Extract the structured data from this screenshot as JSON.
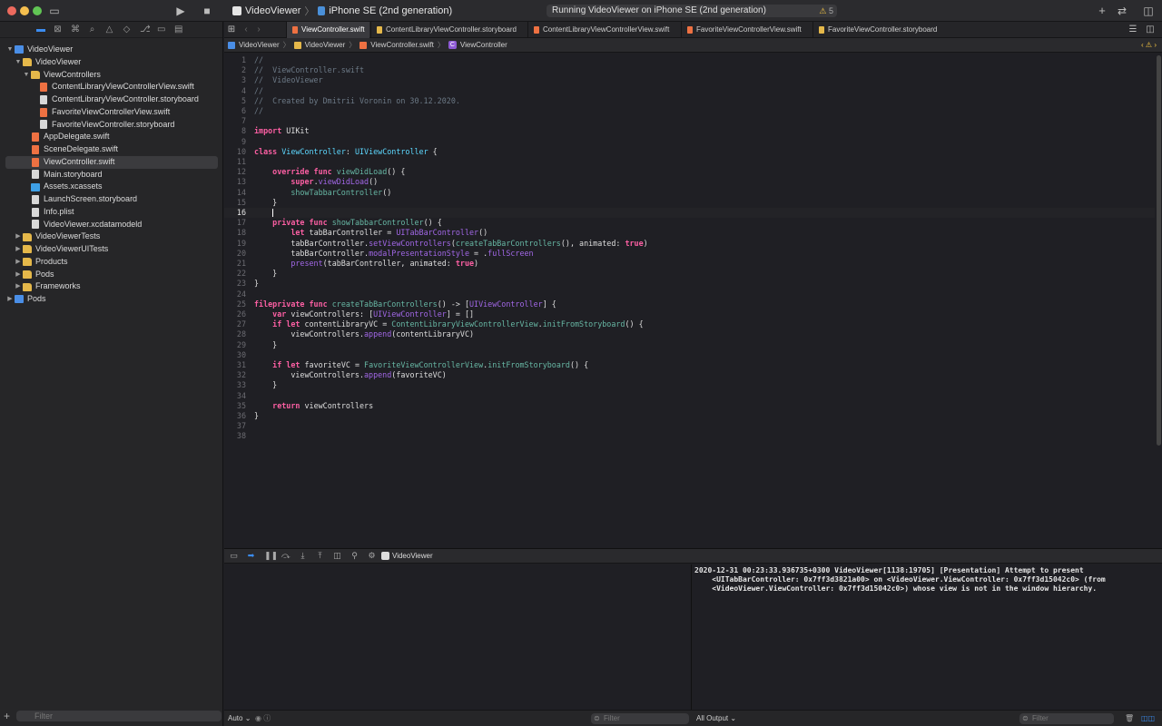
{
  "titlebar": {
    "scheme_name": "VideoViewer",
    "device": "iPhone SE (2nd generation)",
    "status": "Running VideoViewer on iPhone SE (2nd generation)",
    "warning_count": "5"
  },
  "navigator": {
    "filter_placeholder": "Filter",
    "items": [
      {
        "label": "VideoViewer",
        "indent": 0,
        "disclosure": "open",
        "icon": "project"
      },
      {
        "label": "VideoViewer",
        "indent": 1,
        "disclosure": "open",
        "icon": "folder"
      },
      {
        "label": "ViewControllers",
        "indent": 2,
        "disclosure": "open",
        "icon": "folder"
      },
      {
        "label": "ContentLibraryViewControllerView.swift",
        "indent": 3,
        "disclosure": "none",
        "icon": "swift"
      },
      {
        "label": "ContentLibraryViewController.storyboard",
        "indent": 3,
        "disclosure": "none",
        "icon": "file"
      },
      {
        "label": "FavoriteViewControllerView.swift",
        "indent": 3,
        "disclosure": "none",
        "icon": "swift"
      },
      {
        "label": "FavoriteViewController.storyboard",
        "indent": 3,
        "disclosure": "none",
        "icon": "file"
      },
      {
        "label": "AppDelegate.swift",
        "indent": 2,
        "disclosure": "none",
        "icon": "swift"
      },
      {
        "label": "SceneDelegate.swift",
        "indent": 2,
        "disclosure": "none",
        "icon": "swift"
      },
      {
        "label": "ViewController.swift",
        "indent": 2,
        "disclosure": "none",
        "icon": "swift",
        "selected": true
      },
      {
        "label": "Main.storyboard",
        "indent": 2,
        "disclosure": "none",
        "icon": "file"
      },
      {
        "label": "Assets.xcassets",
        "indent": 2,
        "disclosure": "none",
        "icon": "assets"
      },
      {
        "label": "LaunchScreen.storyboard",
        "indent": 2,
        "disclosure": "none",
        "icon": "file"
      },
      {
        "label": "Info.plist",
        "indent": 2,
        "disclosure": "none",
        "icon": "file"
      },
      {
        "label": "VideoViewer.xcdatamodeld",
        "indent": 2,
        "disclosure": "none",
        "icon": "file"
      },
      {
        "label": "VideoViewerTests",
        "indent": 1,
        "disclosure": "closed",
        "icon": "folder"
      },
      {
        "label": "VideoViewerUITests",
        "indent": 1,
        "disclosure": "closed",
        "icon": "folder"
      },
      {
        "label": "Products",
        "indent": 1,
        "disclosure": "closed",
        "icon": "folder"
      },
      {
        "label": "Pods",
        "indent": 1,
        "disclosure": "closed",
        "icon": "folder"
      },
      {
        "label": "Frameworks",
        "indent": 1,
        "disclosure": "closed",
        "icon": "folder"
      },
      {
        "label": "Pods",
        "indent": 0,
        "disclosure": "closed",
        "icon": "project"
      }
    ]
  },
  "tabs": [
    {
      "label": "ViewController.swift",
      "type": "swift",
      "active": true
    },
    {
      "label": "ContentLibraryViewController.storyboard",
      "type": "storyboard",
      "active": false
    },
    {
      "label": "ContentLibraryViewControllerView.swift",
      "type": "swift",
      "active": false
    },
    {
      "label": "FavoriteViewControllerView.swift",
      "type": "swift",
      "active": false
    },
    {
      "label": "FavoriteViewController.storyboard",
      "type": "storyboard",
      "active": false
    }
  ],
  "jumpbar": [
    "VideoViewer",
    "VideoViewer",
    "ViewController.swift",
    "ViewController"
  ],
  "editor": {
    "current_line": 16,
    "lines": [
      [
        [
          "c",
          "//"
        ]
      ],
      [
        [
          "c",
          "//  ViewController.swift"
        ]
      ],
      [
        [
          "c",
          "//  VideoViewer"
        ]
      ],
      [
        [
          "c",
          "//"
        ]
      ],
      [
        [
          "c",
          "//  Created by Dmitrii Voronin on 30.12.2020."
        ]
      ],
      [
        [
          "c",
          "//"
        ]
      ],
      [],
      [
        [
          "k",
          "import"
        ],
        [
          "p",
          " UIKit"
        ]
      ],
      [],
      [
        [
          "k",
          "class"
        ],
        [
          "p",
          " "
        ],
        [
          "t",
          "ViewController"
        ],
        [
          "p",
          ": "
        ],
        [
          "t",
          "UIViewController"
        ],
        [
          "p",
          " {"
        ]
      ],
      [],
      [
        [
          "p",
          "    "
        ],
        [
          "k",
          "override func"
        ],
        [
          "p",
          " "
        ],
        [
          "f",
          "viewDidLoad"
        ],
        [
          "p",
          "() {"
        ]
      ],
      [
        [
          "p",
          "        "
        ],
        [
          "k",
          "super"
        ],
        [
          "p",
          "."
        ],
        [
          "m",
          "viewDidLoad"
        ],
        [
          "p",
          "()"
        ]
      ],
      [
        [
          "p",
          "        "
        ],
        [
          "f",
          "showTabbarController"
        ],
        [
          "p",
          "()"
        ]
      ],
      [
        [
          "p",
          "    }"
        ]
      ],
      [
        [
          "p",
          "    "
        ]
      ],
      [
        [
          "p",
          "    "
        ],
        [
          "k",
          "private func"
        ],
        [
          "p",
          " "
        ],
        [
          "f",
          "showTabbarController"
        ],
        [
          "p",
          "() {"
        ]
      ],
      [
        [
          "p",
          "        "
        ],
        [
          "k",
          "let"
        ],
        [
          "p",
          " tabBarController = "
        ],
        [
          "m",
          "UITabBarController"
        ],
        [
          "p",
          "()"
        ]
      ],
      [
        [
          "p",
          "        tabBarController."
        ],
        [
          "m",
          "setViewControllers"
        ],
        [
          "p",
          "("
        ],
        [
          "f",
          "createTabBarControllers"
        ],
        [
          "p",
          "(), animated: "
        ],
        [
          "k",
          "true"
        ],
        [
          "p",
          ")"
        ]
      ],
      [
        [
          "p",
          "        tabBarController."
        ],
        [
          "m",
          "modalPresentationStyle"
        ],
        [
          "p",
          " = ."
        ],
        [
          "m",
          "fullScreen"
        ]
      ],
      [
        [
          "p",
          "        "
        ],
        [
          "m",
          "present"
        ],
        [
          "p",
          "(tabBarController, animated: "
        ],
        [
          "k",
          "true"
        ],
        [
          "p",
          ")"
        ]
      ],
      [
        [
          "p",
          "    }"
        ]
      ],
      [
        [
          "p",
          "}"
        ]
      ],
      [],
      [
        [
          "k",
          "fileprivate func"
        ],
        [
          "p",
          " "
        ],
        [
          "f",
          "createTabBarControllers"
        ],
        [
          "p",
          "() -> ["
        ],
        [
          "m",
          "UIViewController"
        ],
        [
          "p",
          "] {"
        ]
      ],
      [
        [
          "p",
          "    "
        ],
        [
          "k",
          "var"
        ],
        [
          "p",
          " viewControllers: ["
        ],
        [
          "m",
          "UIViewController"
        ],
        [
          "p",
          "] = []"
        ]
      ],
      [
        [
          "p",
          "    "
        ],
        [
          "k",
          "if let"
        ],
        [
          "p",
          " contentLibraryVC = "
        ],
        [
          "f",
          "ContentLibraryViewControllerView"
        ],
        [
          "p",
          "."
        ],
        [
          "f",
          "initFromStoryboard"
        ],
        [
          "p",
          "() {"
        ]
      ],
      [
        [
          "p",
          "        viewControllers."
        ],
        [
          "m",
          "append"
        ],
        [
          "p",
          "(contentLibraryVC)"
        ]
      ],
      [
        [
          "p",
          "    }"
        ]
      ],
      [],
      [
        [
          "p",
          "    "
        ],
        [
          "k",
          "if let"
        ],
        [
          "p",
          " favoriteVC = "
        ],
        [
          "f",
          "FavoriteViewControllerView"
        ],
        [
          "p",
          "."
        ],
        [
          "f",
          "initFromStoryboard"
        ],
        [
          "p",
          "() {"
        ]
      ],
      [
        [
          "p",
          "        viewControllers."
        ],
        [
          "m",
          "append"
        ],
        [
          "p",
          "(favoriteVC)"
        ]
      ],
      [
        [
          "p",
          "    }"
        ]
      ],
      [],
      [
        [
          "p",
          "    "
        ],
        [
          "k",
          "return"
        ],
        [
          "p",
          " viewControllers"
        ]
      ],
      [
        [
          "p",
          "}"
        ]
      ],
      [],
      []
    ]
  },
  "debug": {
    "target": "VideoViewer",
    "console_lines": [
      "2020-12-31 00:23:33.936735+0300 VideoViewer[1138:19705] [Presentation] Attempt to present",
      "    <UITabBarController: 0x7ff3d3821a00> on <VideoViewer.ViewController: 0x7ff3d15042c0> (from",
      "    <VideoViewer.ViewController: 0x7ff3d15042c0>) whose view is not in the window hierarchy."
    ],
    "auto_label": "Auto",
    "output_label": "All Output",
    "filter_placeholder": "Filter"
  },
  "colors": {
    "keyword": "#fc5fa3",
    "type": "#5dd8ff",
    "function": "#67b7a4",
    "method": "#a167e6",
    "comment": "#6c7986",
    "accent": "#3b8cf0"
  }
}
